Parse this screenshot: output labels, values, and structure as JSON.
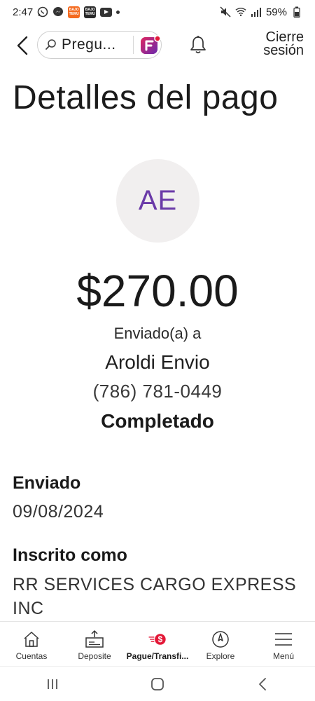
{
  "status_bar": {
    "time": "2:47",
    "badge_text": "BAJO TEMU",
    "battery": "59%"
  },
  "header": {
    "search_text": "Pregu...",
    "logout_label_line1": "Cierre",
    "logout_label_line2": "sesión"
  },
  "page": {
    "title": "Detalles del pago",
    "avatar_initials": "AE",
    "amount": "$270.00",
    "sent_to_label": "Enviado(a) a",
    "recipient_name": "Aroldi Envio",
    "recipient_phone": "(786) 781-0449",
    "status": "Completado"
  },
  "details": {
    "sent_label": "Enviado",
    "sent_value": "09/08/2024",
    "enrolled_label": "Inscrito como",
    "enrolled_value": "RR SERVICES CARGO EXPRESS INC"
  },
  "tabs": [
    {
      "label": "Cuentas",
      "icon": "home-icon"
    },
    {
      "label": "Deposite",
      "icon": "deposit-icon"
    },
    {
      "label": "Pague/Transfi...",
      "icon": "pay-transfer-icon",
      "active": true
    },
    {
      "label": "Explore",
      "icon": "compass-icon"
    },
    {
      "label": "Menú",
      "icon": "hamburger-icon"
    }
  ],
  "colors": {
    "accent_red": "#e31837",
    "avatar_text": "#6a3aa8",
    "avatar_bg": "#f1efef",
    "temu_orange": "#f46a1f"
  }
}
